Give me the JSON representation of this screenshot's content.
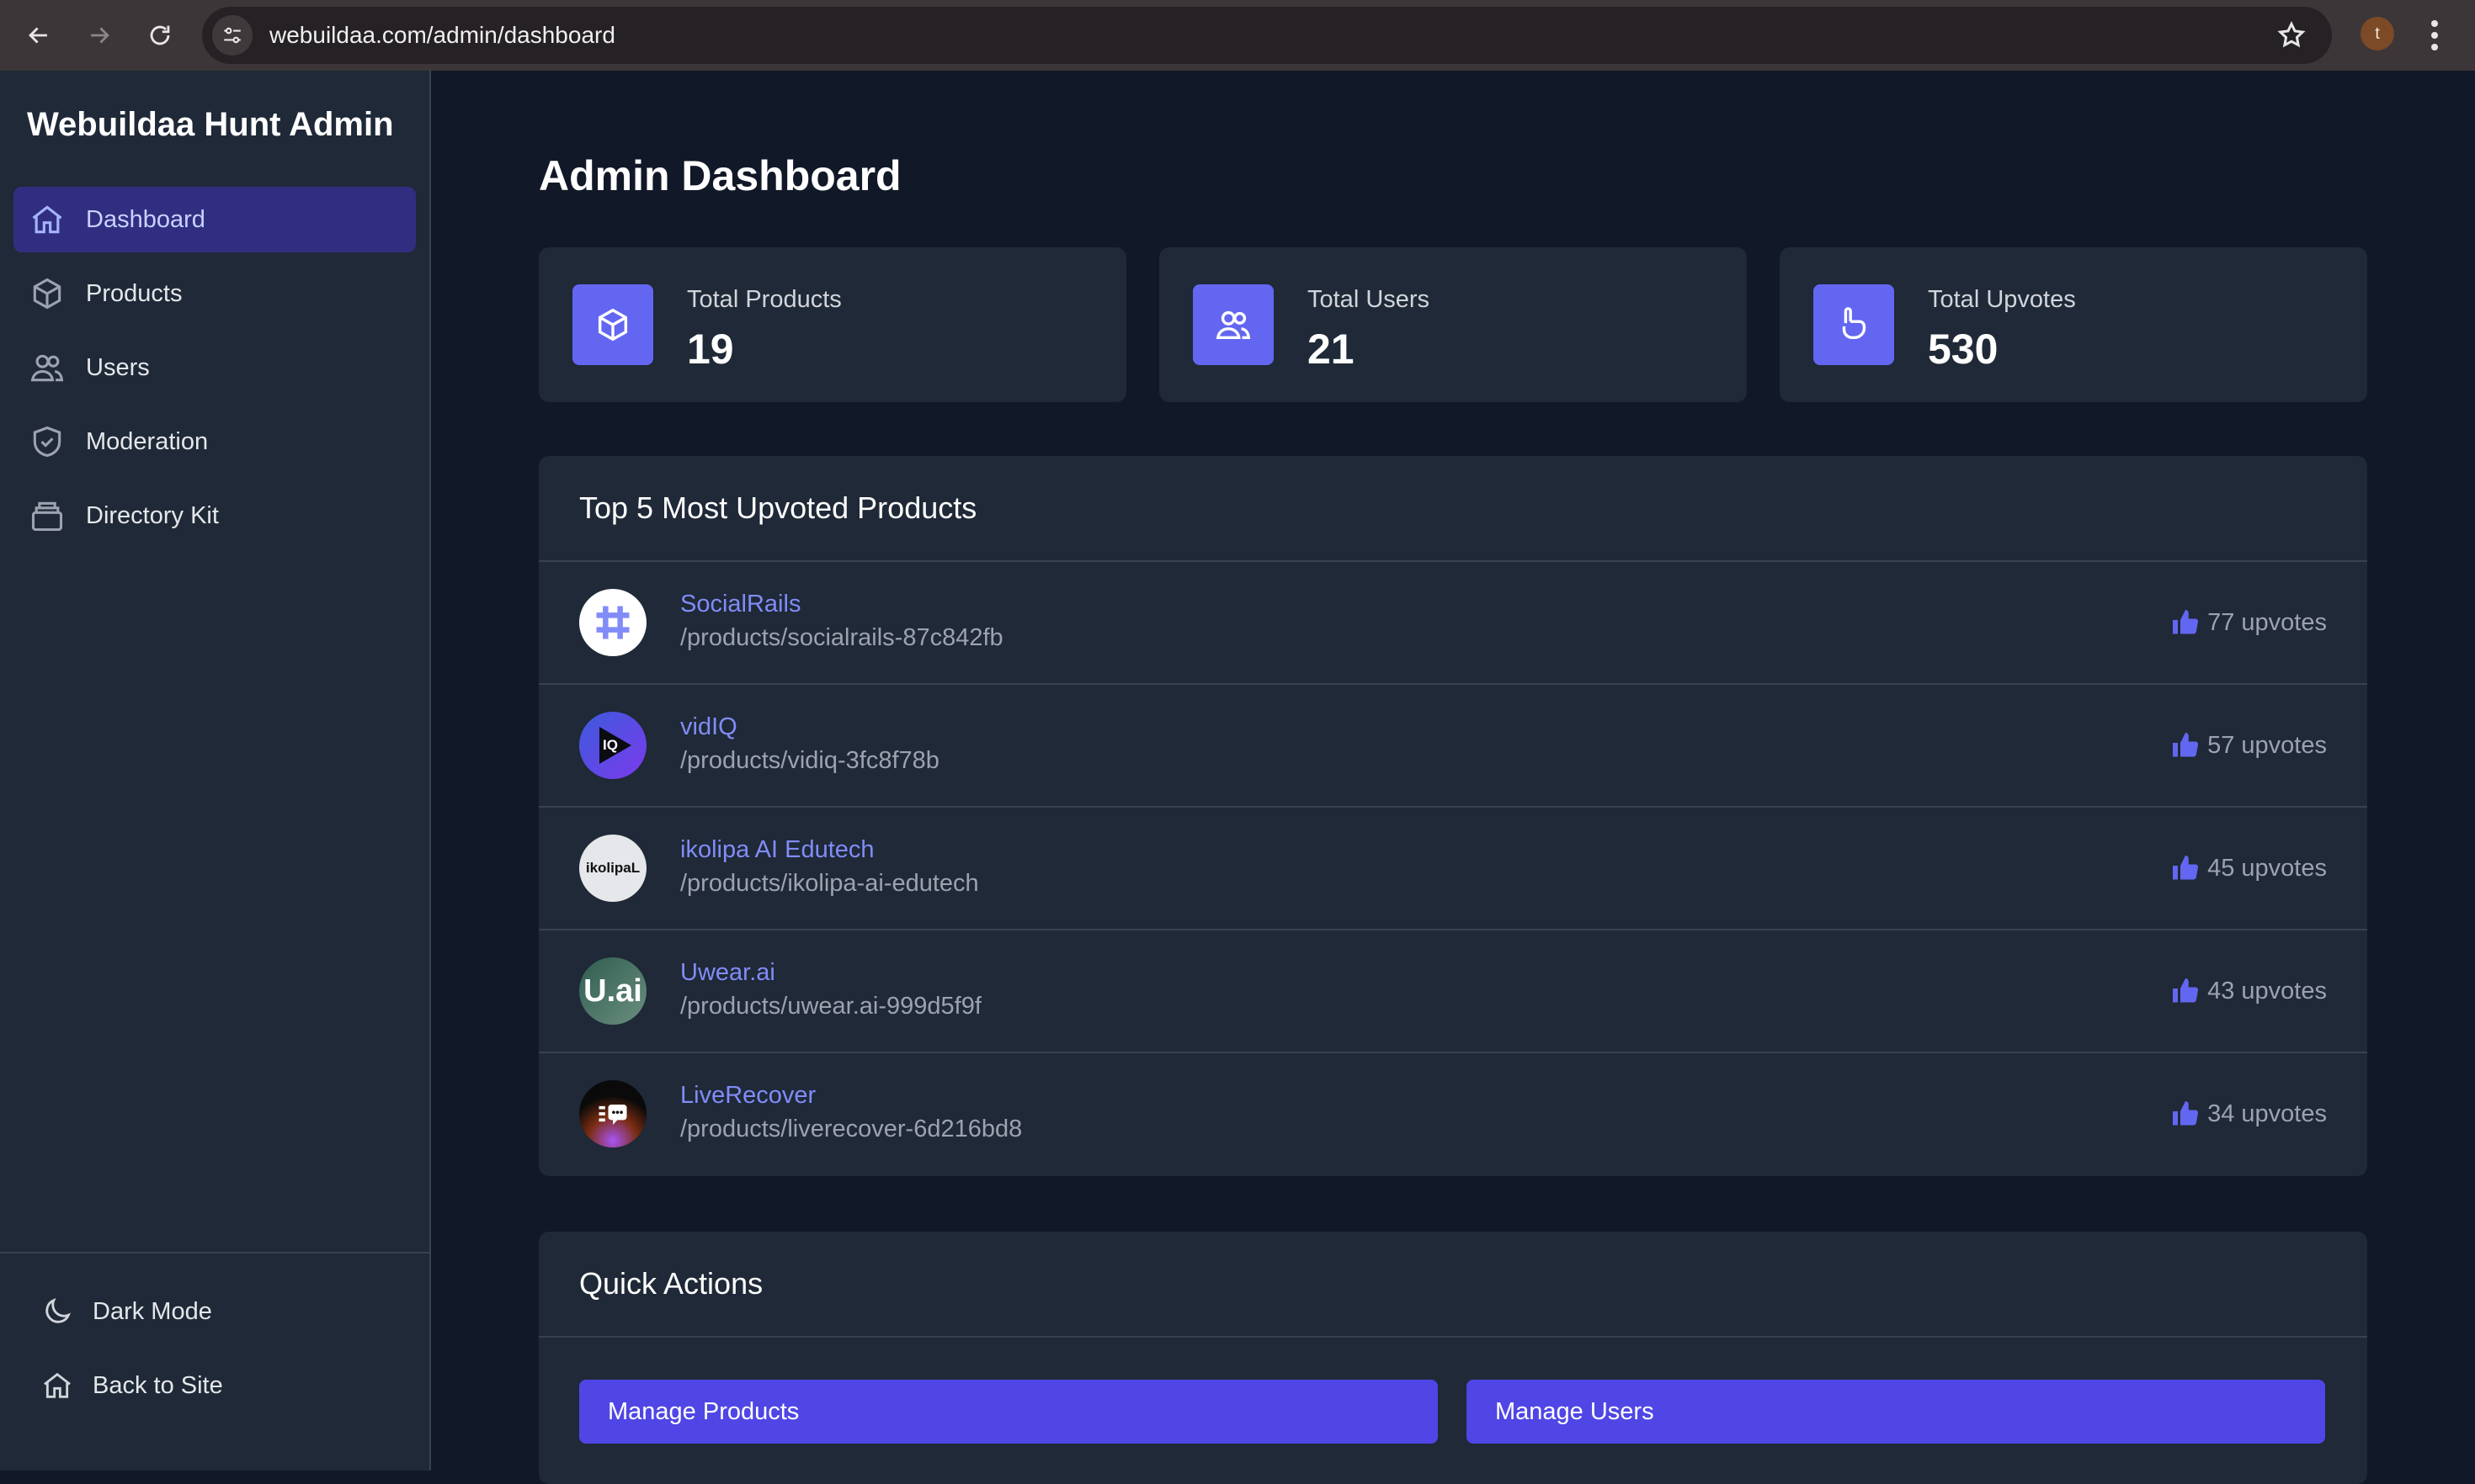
{
  "browser": {
    "url": "webuildaa.com/admin/dashboard",
    "profile_initial": "t"
  },
  "sidebar": {
    "brand": "Webuildaa Hunt Admin",
    "items": [
      {
        "label": "Dashboard",
        "icon": "home-icon",
        "active": true
      },
      {
        "label": "Products",
        "icon": "cube-icon"
      },
      {
        "label": "Users",
        "icon": "users-icon"
      },
      {
        "label": "Moderation",
        "icon": "shield-icon"
      },
      {
        "label": "Directory Kit",
        "icon": "archive-icon"
      }
    ],
    "footer": [
      {
        "label": "Dark Mode",
        "icon": "moon-icon"
      },
      {
        "label": "Back to Site",
        "icon": "home-icon"
      }
    ]
  },
  "main": {
    "title": "Admin Dashboard",
    "stats": [
      {
        "label": "Total Products",
        "value": "19",
        "icon": "cube-icon"
      },
      {
        "label": "Total Users",
        "value": "21",
        "icon": "users-icon"
      },
      {
        "label": "Total Upvotes",
        "value": "530",
        "icon": "hand-thumb-up-icon"
      }
    ],
    "top_products": {
      "title": "Top 5 Most Upvoted Products",
      "items": [
        {
          "name": "SocialRails",
          "path": "/products/socialrails-87c842fb",
          "upvotes": "77 upvotes"
        },
        {
          "name": "vidIQ",
          "path": "/products/vidiq-3fc8f78b",
          "upvotes": "57 upvotes",
          "logo_text": "IQ"
        },
        {
          "name": "ikolipa AI Edutech",
          "path": "/products/ikolipa-ai-edutech",
          "upvotes": "45 upvotes",
          "logo_text": "ikolipaL"
        },
        {
          "name": "Uwear.ai",
          "path": "/products/uwear.ai-999d5f9f",
          "upvotes": "43 upvotes",
          "logo_text": "U.ai"
        },
        {
          "name": "LiveRecover",
          "path": "/products/liverecover-6d216bd8",
          "upvotes": "34 upvotes"
        }
      ]
    },
    "quick_actions": {
      "title": "Quick Actions",
      "buttons": [
        "Manage Products",
        "Manage Users"
      ]
    }
  },
  "colors": {
    "background": "#111827",
    "panel": "#1f2937",
    "accent": "#6366f1",
    "button": "#4f46e5",
    "link": "#818cf8"
  }
}
